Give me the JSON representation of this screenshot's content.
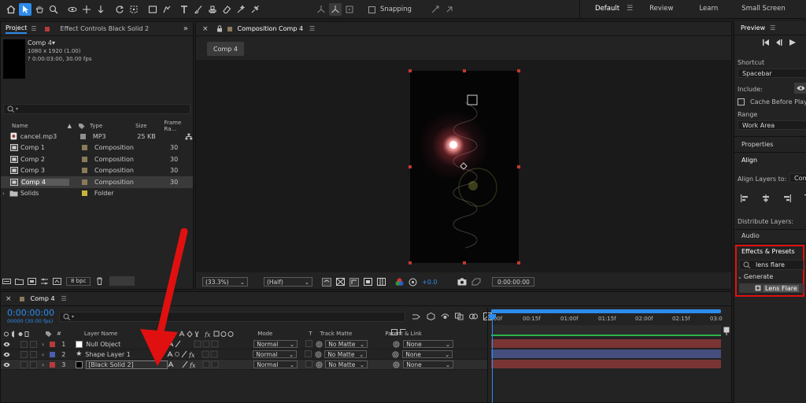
{
  "toolbar": {
    "snapping_label": "Snapping",
    "workspaces": [
      "Default",
      "Review",
      "Learn",
      "Small Screen"
    ]
  },
  "project_panel": {
    "tab_project": "Project",
    "tab_effect_controls": "Effect Controls Black Solid 2",
    "preview_name": "Comp 4▾",
    "preview_dims": "1080 x 1920 (1.00)",
    "preview_duration": "? 0:00:03:00, 30.00 fps",
    "columns": {
      "name": "Name",
      "type": "Type",
      "size": "Size",
      "frame_rate": "Frame Ra..."
    },
    "items": [
      {
        "name": "cancel.mp3",
        "type": "MP3",
        "size": "25 KB",
        "fr": "",
        "color": "#8f8f8f"
      },
      {
        "name": "Comp 1",
        "type": "Composition",
        "size": "",
        "fr": "30",
        "color": "#8a7a5a"
      },
      {
        "name": "Comp 2",
        "type": "Composition",
        "size": "",
        "fr": "30",
        "color": "#8a7a5a"
      },
      {
        "name": "Comp 3",
        "type": "Composition",
        "size": "",
        "fr": "30",
        "color": "#8a7a5a"
      },
      {
        "name": "Comp 4",
        "type": "Composition",
        "size": "",
        "fr": "30",
        "color": "#8a7a5a"
      },
      {
        "name": "Solids",
        "type": "Folder",
        "size": "",
        "fr": "",
        "color": "#c9b43a"
      }
    ],
    "bpc_label": "8 bpc"
  },
  "composition_panel": {
    "title": "Composition Comp 4",
    "breadcrumb": "Comp 4",
    "zoom": "(33.3%)",
    "resolution": "(Half)",
    "exposure": "+0.0",
    "timecode": "0:00:00:00"
  },
  "timeline": {
    "comp_tab": "Comp 4",
    "timecode": "0:00:00:00",
    "frames_fps": "00000 (30.00 fps)",
    "headers": {
      "num": "#",
      "layer_name": "Layer Name",
      "mode": "Mode",
      "t": "T",
      "track_matte": "Track Matte",
      "parent": "Parent & Link"
    },
    "layers": [
      {
        "num": "1",
        "name": "Null Object",
        "color": "#b53b3b",
        "mode": "Normal",
        "matte": "No Matte",
        "parent": "None",
        "bar": "#7a3434"
      },
      {
        "num": "2",
        "name": "Shape Layer 1",
        "color": "#4a5fb0",
        "mode": "Normal",
        "matte": "No Matte",
        "parent": "None",
        "bar": "#454e7d"
      },
      {
        "num": "3",
        "name": "[Black Solid 2]",
        "color": "#b53b3b",
        "mode": "Normal",
        "matte": "No Matte",
        "parent": "None",
        "bar": "#7a3434"
      }
    ],
    "ruler": [
      "0:00f",
      "00:15f",
      "01:00f",
      "01:15f",
      "02:00f",
      "02:15f",
      "03:0"
    ]
  },
  "right_panel": {
    "preview_title": "Preview",
    "shortcut_label": "Shortcut",
    "shortcut_value": "Spacebar",
    "include_label": "Include:",
    "cache_label": "Cache Before Playb",
    "range_label": "Range",
    "range_value": "Work Area",
    "properties": "Properties",
    "align": "Align",
    "align_layers_to": "Align Layers to:",
    "align_target": "Com",
    "distribute_layers": "Distribute Layers:",
    "audio": "Audio",
    "effects_presets": "Effects & Presets",
    "search_value": "lens flare",
    "generate": "Generate",
    "lens_flare": "Lens Flare"
  }
}
